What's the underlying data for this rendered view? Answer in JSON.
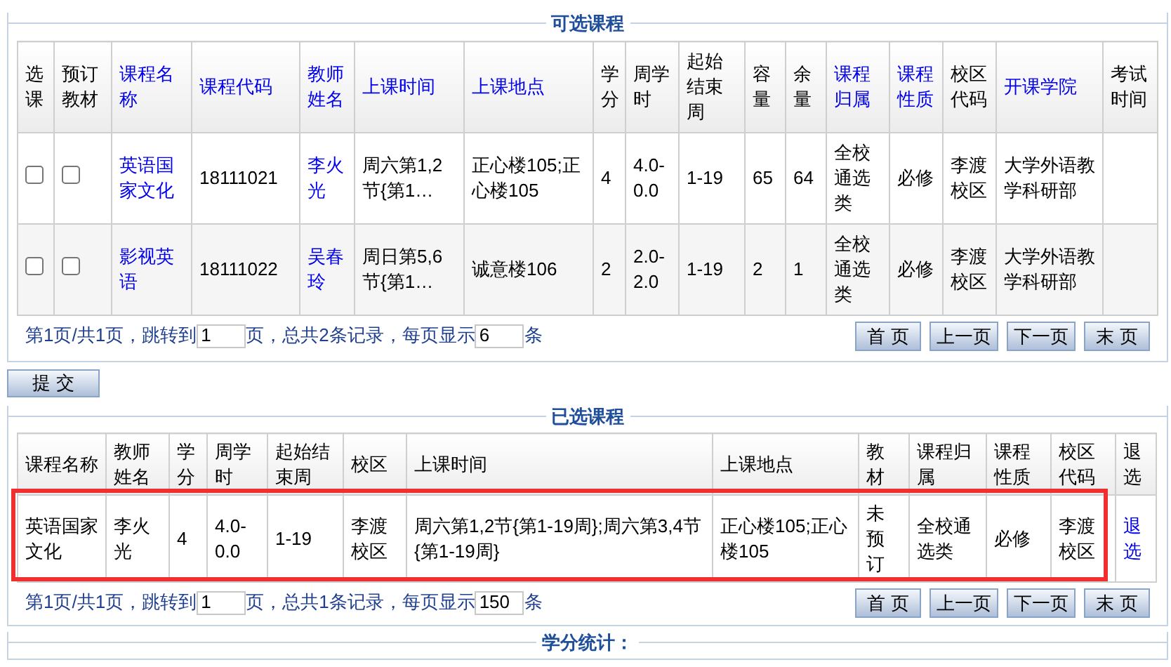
{
  "available": {
    "title": "可选课程",
    "columns": [
      {
        "label": "选课",
        "link": false
      },
      {
        "label": "预订教材",
        "link": false
      },
      {
        "label": "课程名称",
        "link": true
      },
      {
        "label": "课程代码",
        "link": true
      },
      {
        "label": "教师姓名",
        "link": true
      },
      {
        "label": "上课时间",
        "link": true
      },
      {
        "label": "上课地点",
        "link": true
      },
      {
        "label": "学分",
        "link": false
      },
      {
        "label": "周学时",
        "link": false
      },
      {
        "label": "起始结束周",
        "link": false
      },
      {
        "label": "容量",
        "link": false
      },
      {
        "label": "余量",
        "link": false
      },
      {
        "label": "课程归属",
        "link": true
      },
      {
        "label": "课程性质",
        "link": true
      },
      {
        "label": "校区代码",
        "link": false
      },
      {
        "label": "开课学院",
        "link": true
      },
      {
        "label": "考试时间",
        "link": false
      }
    ],
    "rows": [
      {
        "select": false,
        "book": false,
        "name": "英语国家文化",
        "code": "18111021",
        "teacher": "李火光",
        "time": "周六第1,2节{第1…",
        "place": "正心楼105;正心楼105",
        "credit": "4",
        "hours": "4.0-0.0",
        "weeks": "1-19",
        "capacity": "65",
        "remaining": "64",
        "category": "全校通选类",
        "nature": "必修",
        "campus": "李渡校区",
        "college": "大学外语教学科研部"
      },
      {
        "select": false,
        "book": false,
        "name": "影视英语",
        "code": "18111022",
        "teacher": "吴春玲",
        "time": "周日第5,6节{第1…",
        "place": "诚意楼106",
        "credit": "2",
        "hours": "2.0-2.0",
        "weeks": "1-19",
        "capacity": "2",
        "remaining": "1",
        "category": "全校通选类",
        "nature": "必修",
        "campus": "李渡校区",
        "college": "大学外语教学科研部"
      }
    ],
    "pager": {
      "status": "第1页/共1页，跳转到",
      "page": "1",
      "summary": "页，总共2条记录，每页显示",
      "per_page": "6",
      "unit": "条",
      "buttons": [
        "首 页",
        "上一页",
        "下一页",
        "末 页"
      ]
    }
  },
  "submit": "提 交",
  "selected": {
    "title": "已选课程",
    "columns": [
      "课程名称",
      "教师姓名",
      "学分",
      "周学时",
      "起始结束周",
      "校区",
      "上课时间",
      "上课地点",
      "教材",
      "课程归属",
      "课程性质",
      "校区代码",
      "退选"
    ],
    "rows": [
      {
        "highlighted": true,
        "cells": [
          "英语国家文化",
          "李火光",
          "4",
          "4.0-0.0",
          "1-19",
          "李渡校区",
          "周六第1,2节{第1-19周};周六第3,4节{第1-19周}",
          "正心楼105;正心楼105",
          "未预订",
          "全校通选类",
          "必修",
          "李渡校区"
        ],
        "drop": "退选"
      }
    ],
    "pager": {
      "status": "第1页/共1页，跳转到",
      "page": "1",
      "summary": "页，总共1条记录，每页显示",
      "per_page": "150",
      "unit": "条",
      "buttons": [
        "首 页",
        "上一页",
        "下一页",
        "末 页"
      ]
    }
  },
  "credits": {
    "title": "学分统计："
  }
}
